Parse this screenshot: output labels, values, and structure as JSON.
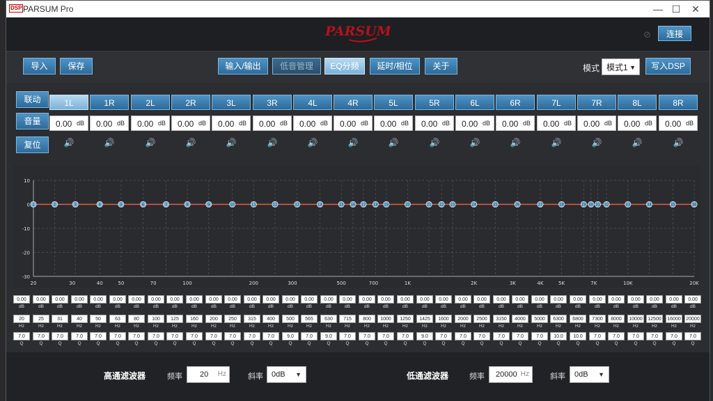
{
  "app": {
    "title": "PARSUM Pro",
    "logo_badge": "DSP",
    "brand": "PARSUM"
  },
  "window_buttons": {
    "minimize": "—",
    "maximize": "☐",
    "close": "✕"
  },
  "header": {
    "connect_label": "连接"
  },
  "toolbar": {
    "import_label": "导入",
    "save_label": "保存",
    "io_label": "输入/输出",
    "bass_label": "低音管理",
    "eq_label": "EQ分频",
    "delay_label": "延时/相位",
    "about_label": "关于",
    "mode_label": "模式",
    "mode_value": "模式1",
    "write_label": "写入DSP"
  },
  "channels": {
    "link_label": "联动",
    "volume_label": "音量",
    "reset_label": "复位",
    "names": [
      "1L",
      "1R",
      "2L",
      "2R",
      "3L",
      "3R",
      "4L",
      "4R",
      "5L",
      "5R",
      "6L",
      "6R",
      "7L",
      "7R",
      "8L",
      "8R"
    ],
    "volume_value": "0.00",
    "volume_unit": "dB",
    "active_index": 0
  },
  "chart_data": {
    "type": "line",
    "xscale": "log",
    "xlim": [
      20,
      20000
    ],
    "ylim": [
      -30,
      10
    ],
    "yticks": [
      10,
      0,
      -10,
      -20,
      -30
    ],
    "xticks": [
      20,
      30,
      40,
      50,
      70,
      100,
      200,
      300,
      500,
      700,
      1000,
      2000,
      3000,
      4000,
      5000,
      7000,
      10000,
      20000
    ],
    "xtick_labels": [
      "20",
      "30",
      "40",
      "50",
      "70",
      "100",
      "200",
      "300",
      "500",
      "700",
      "1K",
      "2K",
      "3K",
      "4K",
      "5K",
      "7K",
      "10K",
      "20K"
    ],
    "series": [
      {
        "color": "#e06040",
        "x": [
          20,
          20000
        ],
        "y": [
          0,
          0
        ]
      }
    ],
    "bands": {
      "freqs": [
        20,
        25,
        31,
        40,
        50,
        63,
        80,
        100,
        125,
        160,
        200,
        250,
        315,
        400,
        500,
        565,
        630,
        715,
        800,
        1000,
        1250,
        1425,
        1600,
        2000,
        2500,
        3150,
        4000,
        5000,
        6300,
        6800,
        7300,
        8000,
        10000,
        12500,
        16000,
        20000
      ],
      "gains": [
        0,
        0,
        0,
        0,
        0,
        0,
        0,
        0,
        0,
        0,
        0,
        0,
        0,
        0,
        0,
        0,
        0,
        0,
        0,
        0,
        0,
        0,
        0,
        0,
        0,
        0,
        0,
        0,
        0,
        0,
        0,
        0,
        0,
        0,
        0,
        0
      ],
      "labels": [
        "1",
        "2",
        "3",
        "4",
        "5",
        "6",
        "7",
        "8",
        "9",
        "10",
        "11",
        "12",
        "13",
        "14",
        "15",
        "16",
        "17",
        "18",
        "19",
        "20",
        "21",
        "22",
        "23",
        "24",
        "25",
        "26",
        "27",
        "28",
        "29",
        "30",
        "31",
        "32",
        "33",
        "34",
        "35",
        "36"
      ]
    },
    "grid": true
  },
  "eq_params": {
    "gains": [
      "0.00",
      "0.00",
      "0.00",
      "0.00",
      "0.00",
      "0.00",
      "0.00",
      "0.00",
      "0.00",
      "0.00",
      "0.00",
      "0.00",
      "0.00",
      "0.00",
      "0.00",
      "0.00",
      "0.00",
      "0.00",
      "0.00",
      "0.00",
      "0.00",
      "0.00",
      "0.00",
      "0.00",
      "0.00",
      "0.00",
      "0.00",
      "0.00",
      "0.00",
      "0.00",
      "0.00",
      "0.00",
      "0.00",
      "0.00",
      "0.00",
      "0.00"
    ],
    "freqs": [
      "20",
      "25",
      "31",
      "40",
      "50",
      "63",
      "80",
      "100",
      "125",
      "160",
      "200",
      "250",
      "315",
      "400",
      "500",
      "565",
      "630",
      "715",
      "800",
      "1000",
      "1250",
      "1425",
      "1600",
      "2000",
      "2500",
      "3150",
      "4000",
      "5000",
      "6300",
      "6800",
      "7300",
      "8000",
      "10000",
      "12500",
      "16000",
      "20000"
    ],
    "qs": [
      "7.0",
      "7.0",
      "7.0",
      "7.0",
      "7.0",
      "7.0",
      "7.0",
      "7.0",
      "7.0",
      "7.0",
      "7.0",
      "7.0",
      "7.0",
      "7.0",
      "9.0",
      "7.0",
      "9.0",
      "7.0",
      "7.0",
      "7.0",
      "7.0",
      "9.0",
      "7.0",
      "7.0",
      "7.0",
      "7.0",
      "7.0",
      "7.0",
      "10.0",
      "10.0",
      "7.0",
      "7.0",
      "7.0",
      "7.0",
      "7.0",
      "7.0"
    ],
    "gain_unit": "dB",
    "freq_unit": "Hz",
    "q_unit": "Q"
  },
  "filters": {
    "hp_label": "高通滤波器",
    "lp_label": "低通滤波器",
    "freq_label": "频率",
    "slope_label": "斜率",
    "hp_freq": "20",
    "lp_freq": "20000",
    "freq_unit": "Hz",
    "hp_slope": "0dB",
    "lp_slope": "0dB"
  }
}
